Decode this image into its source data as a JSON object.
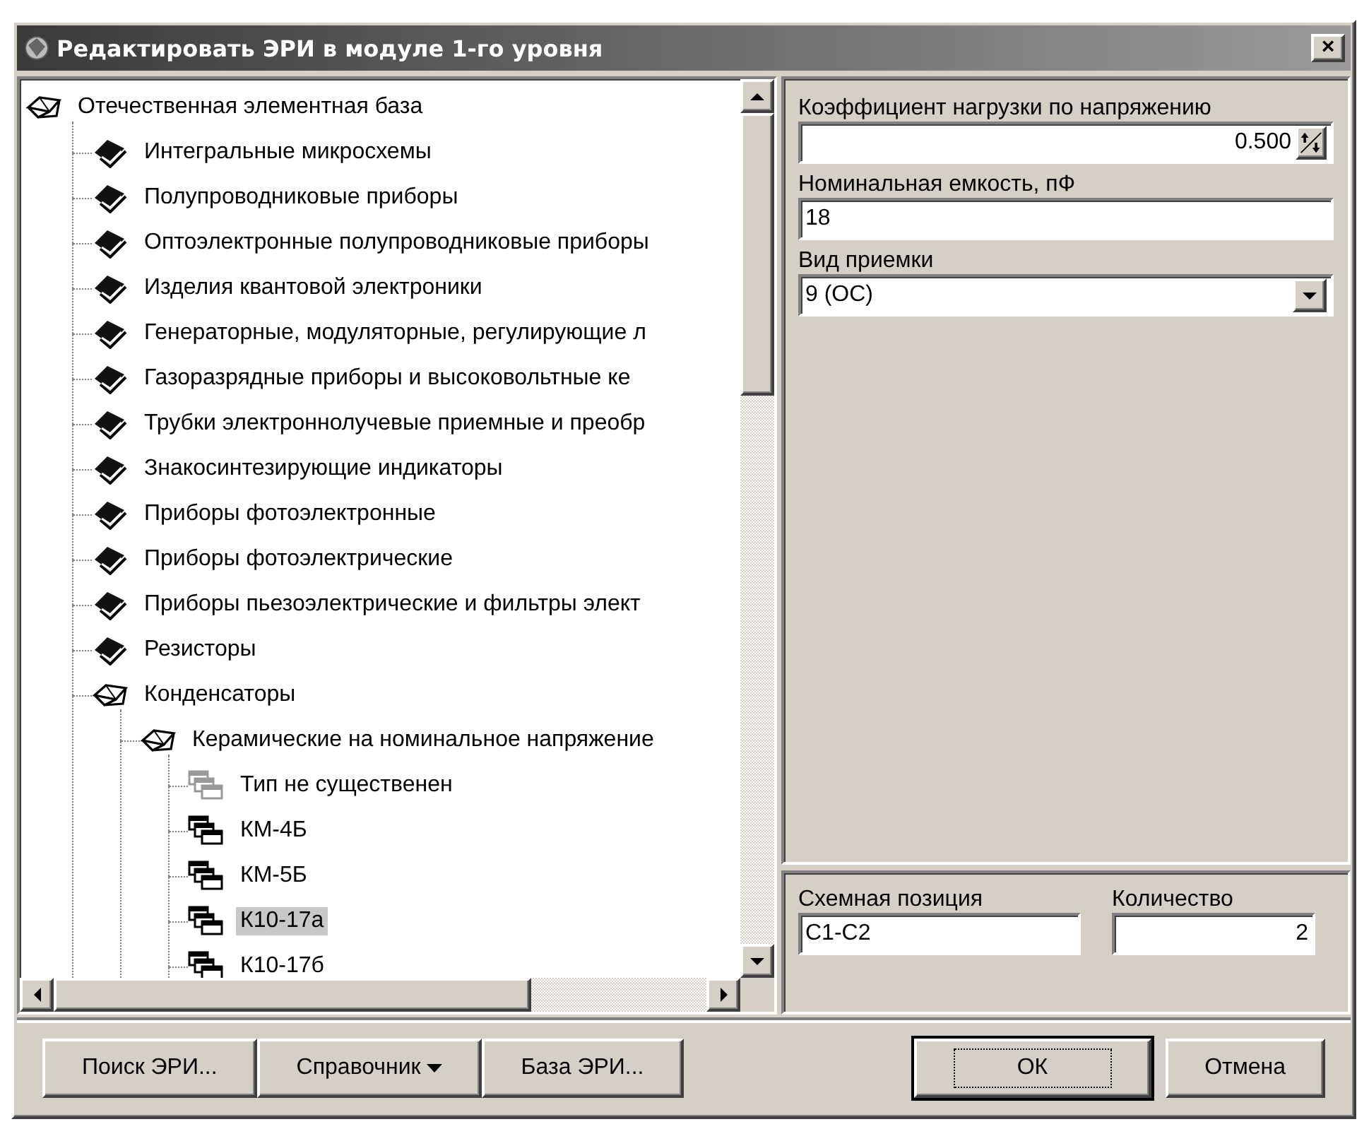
{
  "window": {
    "title": "Редактировать ЭРИ в модуле 1-го уровня",
    "close": "×"
  },
  "tree": {
    "items": [
      {
        "label": "Отечественная элементная база",
        "kind": "group",
        "expanded": true,
        "selected": false,
        "children": [
          {
            "label": "Интегральные микросхемы",
            "kind": "group",
            "expanded": false,
            "selected": false
          },
          {
            "label": "Полупроводниковые приборы",
            "kind": "group",
            "expanded": false,
            "selected": false
          },
          {
            "label": "Оптоэлектронные полупроводниковые приборы",
            "kind": "group",
            "expanded": false,
            "selected": false
          },
          {
            "label": "Изделия квантовой электроники",
            "kind": "group",
            "expanded": false,
            "selected": false
          },
          {
            "label": "Генераторные, модуляторные, регулирующие л",
            "kind": "group",
            "expanded": false,
            "selected": false
          },
          {
            "label": "Газоразрядные приборы и высоковольтные ке",
            "kind": "group",
            "expanded": false,
            "selected": false
          },
          {
            "label": "Трубки электроннолучевые приемные и преобр",
            "kind": "group",
            "expanded": false,
            "selected": false
          },
          {
            "label": "Знакосинтезирующие индикаторы",
            "kind": "group",
            "expanded": false,
            "selected": false
          },
          {
            "label": "Приборы фотоэлектронные",
            "kind": "group",
            "expanded": false,
            "selected": false
          },
          {
            "label": "Приборы фотоэлектрические",
            "kind": "group",
            "expanded": false,
            "selected": false
          },
          {
            "label": "Приборы пьезоэлектрические и фильтры элект",
            "kind": "group",
            "expanded": false,
            "selected": false
          },
          {
            "label": "Резисторы",
            "kind": "group",
            "expanded": false,
            "selected": false
          },
          {
            "label": "Конденсаторы",
            "kind": "group",
            "expanded": true,
            "selected": false,
            "children": [
              {
                "label": "Керамические на номинальное напряжение",
                "kind": "group",
                "expanded": true,
                "selected": false,
                "children": [
                  {
                    "label": "Тип не существенен",
                    "kind": "leaf",
                    "selected": false,
                    "disabled": true
                  },
                  {
                    "label": "КМ-4Б",
                    "kind": "leaf",
                    "selected": false,
                    "disabled": false
                  },
                  {
                    "label": "КМ-5Б",
                    "kind": "leaf",
                    "selected": false,
                    "disabled": false
                  },
                  {
                    "label": "К10-17а",
                    "kind": "leaf",
                    "selected": true,
                    "disabled": false
                  },
                  {
                    "label": "К10-17б",
                    "kind": "leaf",
                    "selected": false,
                    "disabled": false
                  }
                ]
              }
            ]
          }
        ]
      }
    ]
  },
  "parameters": [
    {
      "label": "Коэффициент нагрузки по напряжению",
      "kind": "spin",
      "value": "0.500"
    },
    {
      "label": "Номинальная емкость, пФ",
      "kind": "text",
      "value": "18"
    },
    {
      "label": "Вид приемки",
      "kind": "combo",
      "value": "9 (ОС)"
    }
  ],
  "position": {
    "label": "Схемная позиция",
    "value": "С1-С2"
  },
  "quantity": {
    "label": "Количество",
    "value": "2"
  },
  "tool_buttons": [
    {
      "label": "Поиск ЭРИ...",
      "kind": "plain",
      "default": false
    },
    {
      "label": "Справочник",
      "kind": "menu",
      "default": false
    },
    {
      "label": "База ЭРИ...",
      "kind": "plain",
      "default": false
    }
  ],
  "dialog_buttons": [
    {
      "label": "ОК",
      "default": true
    },
    {
      "label": "Отмена",
      "default": false
    }
  ]
}
